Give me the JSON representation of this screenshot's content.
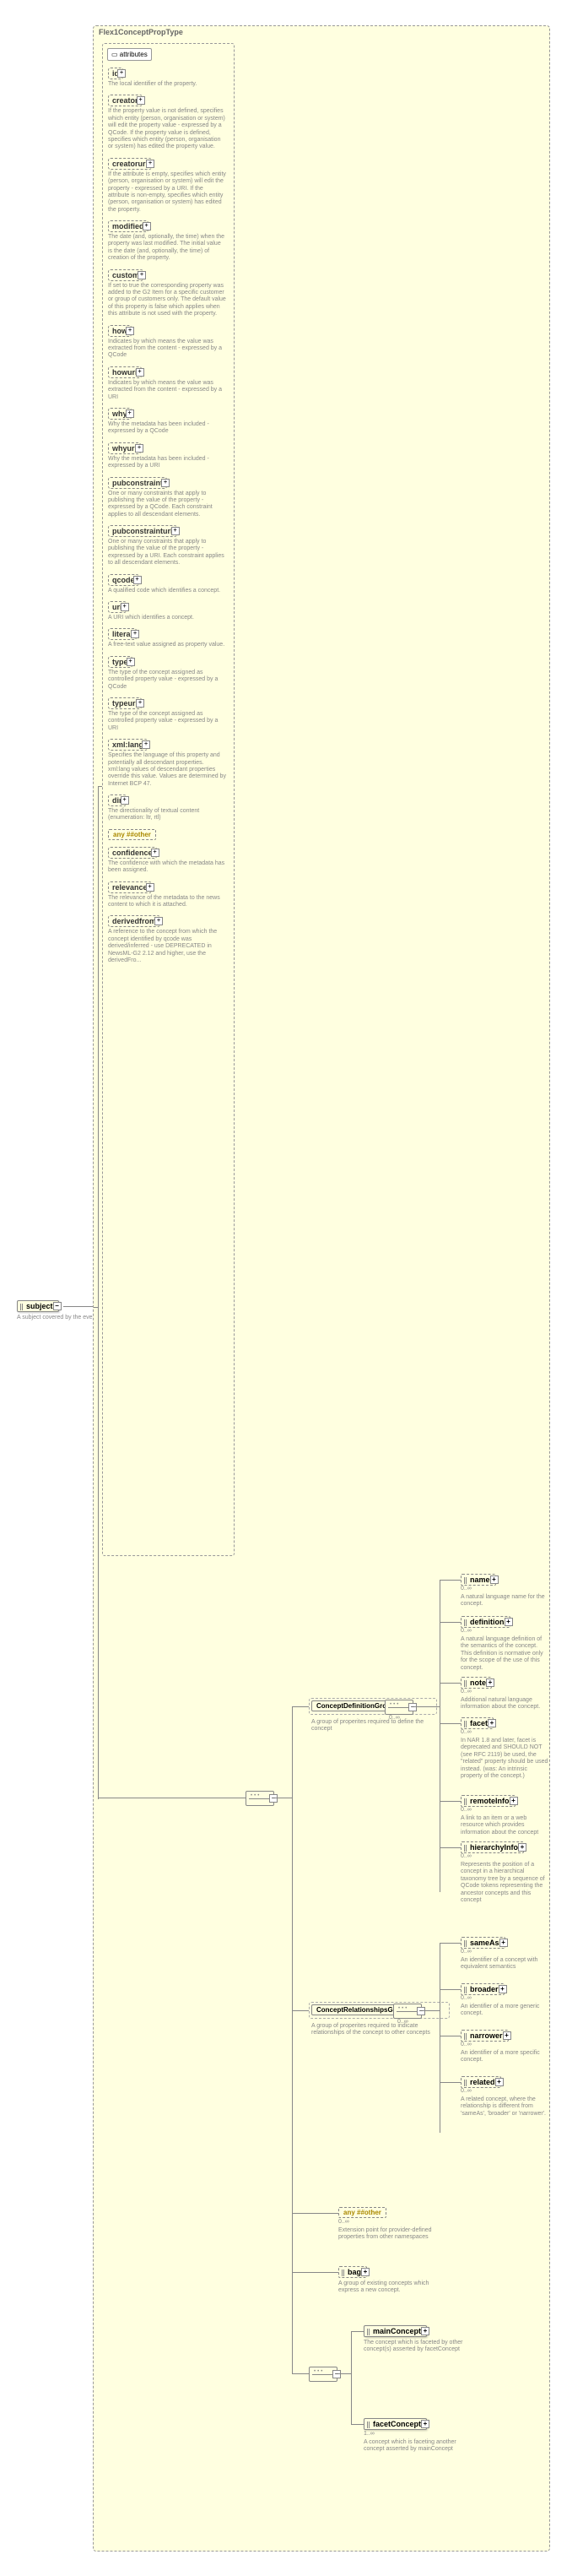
{
  "panel_title": "Flex1ConceptPropType",
  "attributes_label": "attributes",
  "subject": {
    "name": "subject",
    "desc": "A subject covered by the event."
  },
  "attrs": [
    {
      "name": "id",
      "desc": "The local identifier of the property."
    },
    {
      "name": "creator",
      "desc": "If the property value is not defined, specifies which entity (person, organisation or system) will edit the property value - expressed by a QCode. If the property value is defined, specifies which entity (person, organisation or system) has edited the property value."
    },
    {
      "name": "creatoruri",
      "desc": "If the attribute is empty, specifies which entity (person, organisation or system) will edit the property - expressed by a URI. If the attribute is non-empty, specifies which entity (person, organisation or system) has edited the property."
    },
    {
      "name": "modified",
      "desc": "The date (and, optionally, the time) when the property was last modified. The initial value is the date (and, optionally, the time) of creation of the property."
    },
    {
      "name": "custom",
      "desc": "If set to true the corresponding property was added to the G2 Item for a specific customer or group of customers only. The default value of this property is false which applies when this attribute is not used with the property."
    },
    {
      "name": "how",
      "desc": "Indicates by which means the value was extracted from the content - expressed by a QCode"
    },
    {
      "name": "howuri",
      "desc": "Indicates by which means the value was extracted from the content - expressed by a URI"
    },
    {
      "name": "why",
      "desc": "Why the metadata has been included - expressed by a QCode"
    },
    {
      "name": "whyuri",
      "desc": "Why the metadata has been included - expressed by a URI"
    },
    {
      "name": "pubconstraint",
      "desc": "One or many constraints that apply to publishing the value of the property - expressed by a QCode. Each constraint applies to all descendant elements."
    },
    {
      "name": "pubconstrainturi",
      "desc": "One or many constraints that apply to publishing the value of the property - expressed by a URI. Each constraint applies to all descendant elements."
    },
    {
      "name": "qcode",
      "desc": "A qualified code which identifies a concept."
    },
    {
      "name": "uri",
      "desc": "A URI which identifies a concept."
    },
    {
      "name": "literal",
      "desc": "A free-text value assigned as property value."
    },
    {
      "name": "type",
      "desc": "The type of the concept assigned as controlled property value - expressed by a QCode"
    },
    {
      "name": "typeuri",
      "desc": "The type of the concept assigned as controlled property value - expressed by a URI"
    },
    {
      "name": "xml:lang",
      "desc": "Specifies the language of this property and potentially all descendant properties. xml:lang values of descendant properties override this value. Values are determined by Internet BCP 47."
    },
    {
      "name": "dir",
      "desc": "The directionality of textual content (enumeration: ltr, rtl)"
    },
    {
      "name": "any ##other",
      "any": true
    },
    {
      "name": "confidence",
      "desc": "The confidence with which the metadata has been assigned."
    },
    {
      "name": "relevance",
      "desc": "The relevance of the metadata to the news content to which it is attached."
    },
    {
      "name": "derivedfrom",
      "desc": "A reference to the concept from which the concept identified by qcode was derived/inferred - use DEPRECATED in NewsML-G2 2.12 and higher, use the derivedFro..."
    }
  ],
  "groups": {
    "def": {
      "name": "ConceptDefinitionGroup",
      "desc": "A group of properites required to define the concept"
    },
    "rel": {
      "name": "ConceptRelationshipsGroup",
      "desc": "A group of properites required to indicate relationships of the concept to other concepts"
    }
  },
  "right_def": [
    {
      "name": "name",
      "desc": "A natural language name for the concept."
    },
    {
      "name": "definition",
      "desc": "A natural language definition of the semantics of the concept. This definition is normative only for the scope of the use of this concept."
    },
    {
      "name": "note",
      "desc": "Additional natural language information about the concept."
    },
    {
      "name": "facet",
      "desc": "In NAR 1.8 and later, facet is deprecated and SHOULD NOT (see RFC 2119) be used, the \"related\" property should be used instead. (was: An intrinsic property of the concept.)"
    },
    {
      "name": "remoteInfo",
      "desc": "A link to an item or a web resource which provides information about the concept"
    },
    {
      "name": "hierarchyInfo",
      "desc": "Represents the position of a concept in a hierarchical taxonomy tree by a sequence of QCode tokens representing the ancestor concepts and this concept"
    }
  ],
  "right_rel": [
    {
      "name": "sameAs",
      "desc": "An identifier of a concept with equivalent semantics"
    },
    {
      "name": "broader",
      "desc": "An identifier of a more generic concept."
    },
    {
      "name": "narrower",
      "desc": "An identifier of a more specific concept."
    },
    {
      "name": "related",
      "desc": "A related concept, where the relationship is different from 'sameAs', 'broader' or 'narrower'."
    }
  ],
  "bottom": {
    "any": "any ##other",
    "any_desc": "Extension point for provider-defined properties from other namespaces",
    "bag": "bag",
    "bag_desc": "A group of existing concepts which express a new concept.",
    "mainConcept": "mainConcept",
    "mainConcept_desc": "The concept which is faceted by other concept(s) asserted by facetConcept",
    "facetConcept": "facetConcept",
    "facetConcept_desc": "A concept which is faceting another concept asserted by mainConcept"
  },
  "card": {
    "zero_inf": "0..∞",
    "one_inf": "1..∞"
  }
}
